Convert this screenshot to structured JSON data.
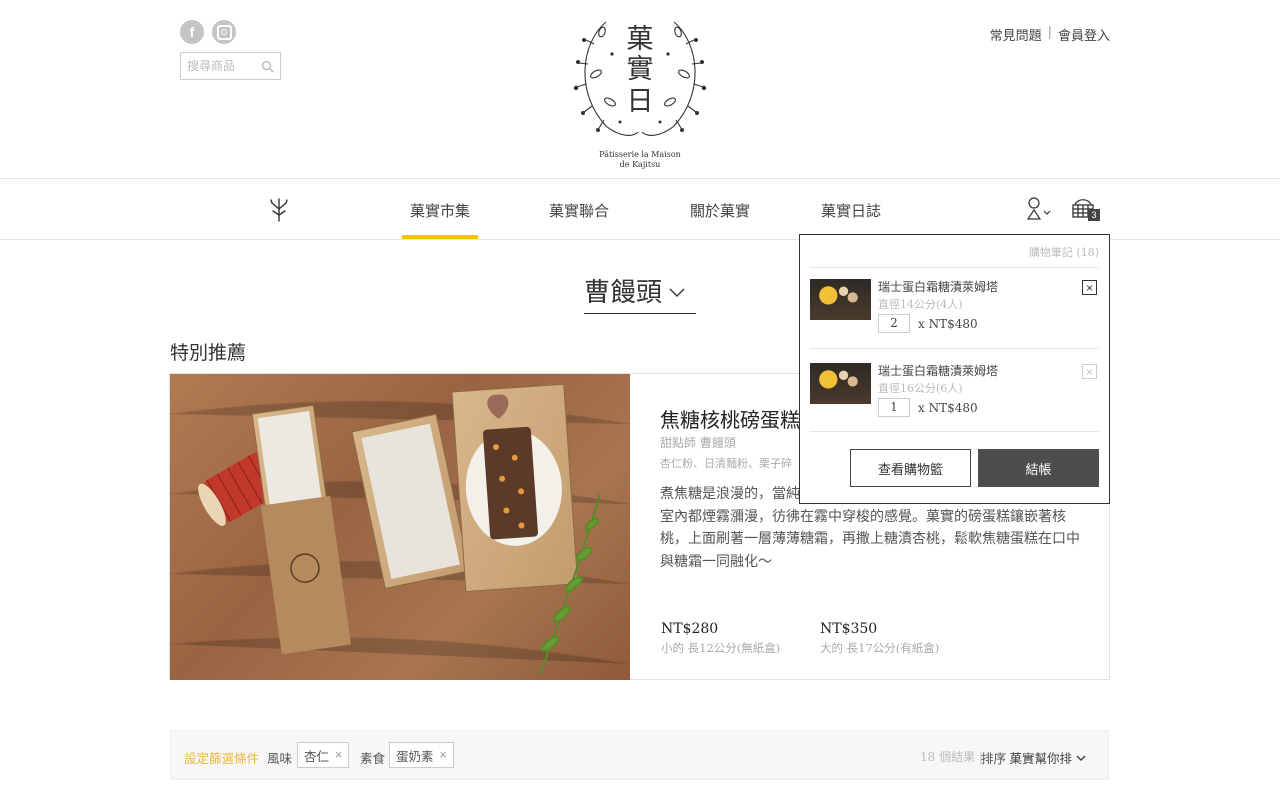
{
  "header": {
    "search_placeholder": "搜尋商品",
    "logo_title": "菓實日",
    "logo_caption_1": "Pâtisserie la Maison",
    "logo_caption_2": "de Kajitsu",
    "faq": "常見問題",
    "login": "會員登入",
    "divider": "|"
  },
  "nav": {
    "items": [
      {
        "label": "菓實市集"
      },
      {
        "label": "菓實聯合"
      },
      {
        "label": "關於菓實"
      },
      {
        "label": "菓實日誌"
      }
    ],
    "cart_count": "3"
  },
  "category": {
    "title": "曹饅頭"
  },
  "section": {
    "title": "特別推薦"
  },
  "featured": {
    "name": "焦糖核桃磅蛋糕",
    "chef": "甜點師 曹饅頭",
    "ingredients": "杏仁粉、日清麵粉、栗子碎",
    "description": "煮焦糖是浪漫的，當純白的砂糖慢慢融化，微苦的焦香氣息瀰漫整個室內都煙霧瀰漫，彷彿在霧中穿梭的感覺。菓實的磅蛋糕鑲嵌著核桃，上面刷著一層薄薄糖霜，再撒上糖漬杏桃，鬆軟焦糖蛋糕在口中與糖霜一同融化～",
    "prices": [
      {
        "amount": "NT$280",
        "note": "小的 長12公分(無紙盒)"
      },
      {
        "amount": "NT$350",
        "note": "大的 長17公分(有紙盒)"
      }
    ]
  },
  "filter": {
    "label": "設定篩選條件",
    "groups": [
      {
        "name": "風味",
        "chip": "杏仁"
      },
      {
        "name": "素食",
        "chip": "蛋奶素"
      }
    ],
    "count": "18 個結果",
    "count_divider": "|",
    "sort_label": "排序",
    "sort_value": "菓實幫你排"
  },
  "cart": {
    "header": "購物筆記 (18)",
    "items": [
      {
        "name": "瑞士蛋白霜糖漬萊姆塔",
        "size": "直徑14公分(4人)",
        "qty": "2",
        "unit": "x NT$480"
      },
      {
        "name": "瑞士蛋白霜糖漬萊姆塔",
        "size": "直徑16公分(6人)",
        "qty": "1",
        "unit": "x NT$480"
      }
    ],
    "view_label": "查看購物籃",
    "checkout_label": "結帳"
  }
}
